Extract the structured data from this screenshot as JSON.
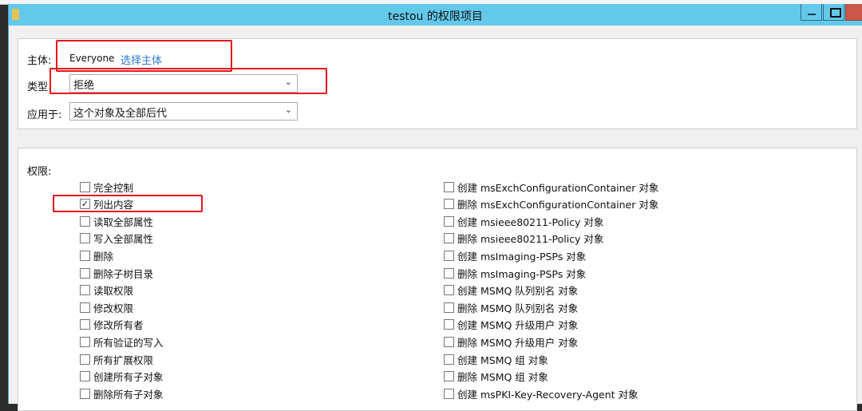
{
  "window": {
    "title": "testou 的权限项目"
  },
  "principal": {
    "label": "主体:",
    "value": "Everyone",
    "select_link": "选择主体"
  },
  "type": {
    "label": "类型",
    "value": "拒绝"
  },
  "applies_to": {
    "label": "应用于:",
    "value": "这个对象及全部后代"
  },
  "permissions": {
    "label": "权限:",
    "left": [
      {
        "label": "完全控制",
        "checked": false
      },
      {
        "label": "列出内容",
        "checked": true
      },
      {
        "label": "读取全部属性",
        "checked": false
      },
      {
        "label": "写入全部属性",
        "checked": false
      },
      {
        "label": "删除",
        "checked": false
      },
      {
        "label": "删除子树目录",
        "checked": false
      },
      {
        "label": "读取权限",
        "checked": false
      },
      {
        "label": "修改权限",
        "checked": false
      },
      {
        "label": "修改所有者",
        "checked": false
      },
      {
        "label": "所有验证的写入",
        "checked": false
      },
      {
        "label": "所有扩展权限",
        "checked": false
      },
      {
        "label": "创建所有子对象",
        "checked": false
      },
      {
        "label": "删除所有子对象",
        "checked": false
      }
    ],
    "right": [
      {
        "label": "创建 msExchConfigurationContainer 对象",
        "checked": false
      },
      {
        "label": "删除 msExchConfigurationContainer 对象",
        "checked": false
      },
      {
        "label": "创建 msieee80211-Policy 对象",
        "checked": false
      },
      {
        "label": "删除 msieee80211-Policy 对象",
        "checked": false
      },
      {
        "label": "创建 msImaging-PSPs 对象",
        "checked": false
      },
      {
        "label": "删除 msImaging-PSPs 对象",
        "checked": false
      },
      {
        "label": "创建 MSMQ 队列别名 对象",
        "checked": false
      },
      {
        "label": "删除 MSMQ 队列别名 对象",
        "checked": false
      },
      {
        "label": "创建 MSMQ 升级用户 对象",
        "checked": false
      },
      {
        "label": "删除 MSMQ 升级用户 对象",
        "checked": false
      },
      {
        "label": "创建 MSMQ 组 对象",
        "checked": false
      },
      {
        "label": "删除 MSMQ 组 对象",
        "checked": false
      },
      {
        "label": "创建 msPKI-Key-Recovery-Agent 对象",
        "checked": false
      }
    ]
  }
}
